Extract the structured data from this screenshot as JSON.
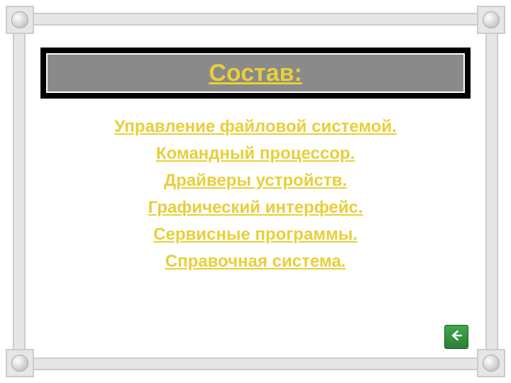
{
  "title": "Состав:",
  "items": [
    "Управление файловой системой.",
    "Командный процессор.",
    "Драйверы устройств.",
    "Графический интерфейс.",
    "Сервисные программы.",
    "Справочная система."
  ],
  "colors": {
    "accent": "#e8cf3a",
    "title_bg": "#8a8a8a",
    "frame": "#e6e6e6",
    "back_btn": "#3fa84a"
  }
}
